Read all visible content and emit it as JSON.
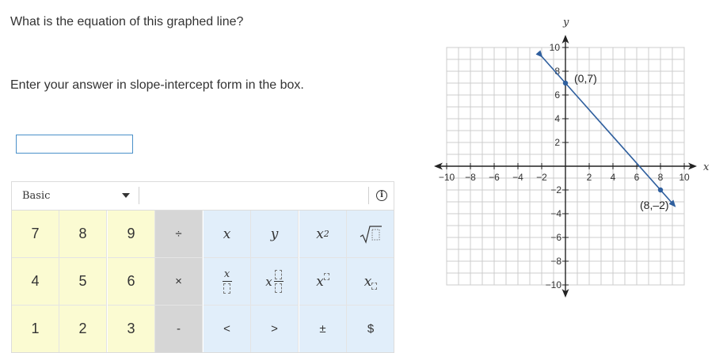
{
  "question": "What is the equation of this graphed line?",
  "instruction": "Enter your answer in slope-intercept form in the box.",
  "answer": {
    "value": ""
  },
  "keypad": {
    "mode": "Basic",
    "info_icon": "info-icon",
    "keys": {
      "seven": "7",
      "eight": "8",
      "nine": "9",
      "divide": "÷",
      "x": "x",
      "y": "y",
      "x_squared_base": "x",
      "x_squared_exp": "2",
      "four": "4",
      "five": "5",
      "six": "6",
      "times": "×",
      "frac_x": "x",
      "mixed_x": "x",
      "power_x": "x",
      "sub_x": "x",
      "one": "1",
      "two": "2",
      "three": "3",
      "minus": "-",
      "less": "<",
      "greater": ">",
      "plus_minus": "±",
      "dollar": "$"
    }
  },
  "graph": {
    "x_axis_label": "x",
    "y_axis_label": "y",
    "x_ticks": [
      "−10",
      "−8",
      "−6",
      "−4",
      "−2",
      "2",
      "4",
      "6",
      "8",
      "10"
    ],
    "y_ticks_pos": [
      "10",
      "8",
      "6",
      "4",
      "2"
    ],
    "y_ticks_neg": [
      "−2",
      "−4",
      "−6",
      "−8",
      "−10"
    ],
    "point_a_label": "(0,7)",
    "point_b_label": "(8,–2)",
    "line_color": "#2f5f9e"
  }
}
